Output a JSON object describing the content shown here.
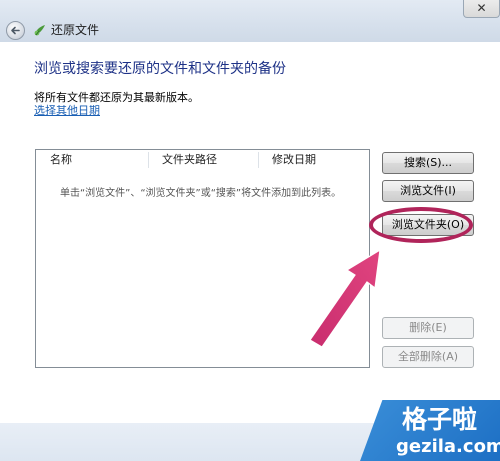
{
  "window": {
    "title": "还原文件",
    "close_label": "✕"
  },
  "heading": "浏览或搜索要还原的文件和文件夹的备份",
  "info_text": "将所有文件都还原为其最新版本。",
  "choose_date_link": "选择其他日期",
  "file_list": {
    "columns": [
      "名称",
      "文件夹路径",
      "修改日期"
    ],
    "empty_hint": "单击“浏览文件”、“浏览文件夹”或“搜索”将文件添加到此列表。"
  },
  "buttons": {
    "search": "搜索(S)...",
    "browse_files": "浏览文件(I)",
    "browse_folders": "浏览文件夹(O)",
    "remove": "删除(E)",
    "remove_all": "全部删除(A)"
  },
  "watermark": {
    "name": "格子啦",
    "url": "gezila.com"
  },
  "colors": {
    "heading": "#1e3287",
    "link": "#1a5fb4",
    "annotation": "#b0245a",
    "watermark": "#2a80d0"
  }
}
